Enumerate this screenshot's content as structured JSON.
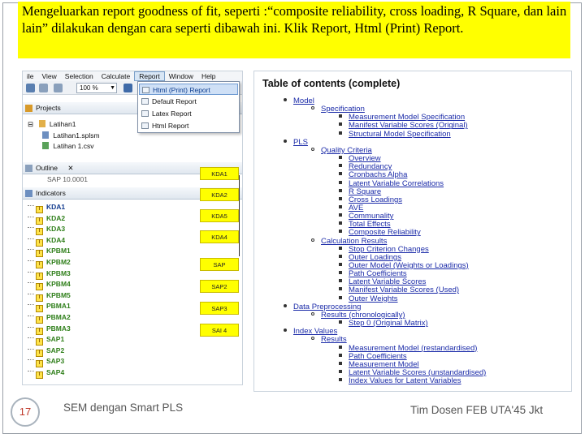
{
  "banner": {
    "text": "Mengeluarkan report goodness of fit, seperti  :“composite reliability, cross loading,  R Square,  dan lain lain”  dilakukan dengan cara seperti dibawah ini. Klik Report, Html (Print) Report."
  },
  "app": {
    "menu": [
      "ile",
      "View",
      "Selection",
      "Calculate",
      "Report",
      "Window",
      "Help"
    ],
    "zoom_value": "100 %",
    "report_menu": [
      {
        "label": "Html (Print) Report",
        "icon": "html-report-icon",
        "selected": true
      },
      {
        "label": "Default Report",
        "icon": "default-report-icon"
      },
      {
        "label": "Latex Report",
        "icon": "latex-report-icon"
      },
      {
        "label": "Html Report",
        "icon": "html-report-icon"
      }
    ],
    "projects_title": "Projects",
    "project_tree": [
      "Latihan1",
      "Latihan1.splsm",
      "Latihan 1.csv"
    ],
    "outline_title": "Outline",
    "outline_close": "✕",
    "outline_item": "SAP 10.0001",
    "indicators_title": "Indicators",
    "indicators": [
      "KDA1",
      "KDA2",
      "KDA3",
      "KDA4",
      "KPBM1",
      "KPBM2",
      "KPBM3",
      "KPBM4",
      "KPBM5",
      "PBMA1",
      "PBMA2",
      "PBMA3",
      "SAP1",
      "SAP2",
      "SAP3",
      "SAP4"
    ],
    "canvas_boxes": [
      "KDA1",
      "KDA2",
      "KDA5",
      "KDA4",
      "SAP",
      "SAP2",
      "SAP3",
      "SAI 4"
    ],
    "colors": {
      "indicator_text": "#2f7f1a",
      "box_fill": "#ffff00",
      "menu_highlight": "#cfe0f6"
    }
  },
  "report": {
    "title": "Table of contents (complete)",
    "entries": [
      {
        "level": 1,
        "text": "Model"
      },
      {
        "level": 2,
        "text": "Specification"
      },
      {
        "level": 3,
        "text": "Measurement Model Specification"
      },
      {
        "level": 3,
        "text": "Manifest Variable Scores (Original)"
      },
      {
        "level": 3,
        "text": "Structural Model Specification"
      },
      {
        "level": 1,
        "text": "PLS"
      },
      {
        "level": 2,
        "text": "Quality Criteria"
      },
      {
        "level": 3,
        "text": "Overview"
      },
      {
        "level": 3,
        "text": "Redundancy"
      },
      {
        "level": 3,
        "text": "Cronbachs Alpha"
      },
      {
        "level": 3,
        "text": "Latent Variable Correlations"
      },
      {
        "level": 3,
        "text": "R Square"
      },
      {
        "level": 3,
        "text": "Cross Loadings"
      },
      {
        "level": 3,
        "text": "AVE"
      },
      {
        "level": 3,
        "text": "Communality"
      },
      {
        "level": 3,
        "text": "Total Effects"
      },
      {
        "level": 3,
        "text": "Composite Reliability"
      },
      {
        "level": 2,
        "text": "Calculation Results"
      },
      {
        "level": 3,
        "text": "Stop Criterion Changes"
      },
      {
        "level": 3,
        "text": "Outer Loadings"
      },
      {
        "level": 3,
        "text": "Outer Model (Weights or Loadings)"
      },
      {
        "level": 3,
        "text": "Path Coefficients"
      },
      {
        "level": 3,
        "text": "Latent Variable Scores"
      },
      {
        "level": 3,
        "text": "Manifest Variable Scores (Used)"
      },
      {
        "level": 3,
        "text": "Outer Weights"
      },
      {
        "level": 1,
        "text": "Data Preprocessing"
      },
      {
        "level": 2,
        "text": "Results (chronologically)"
      },
      {
        "level": 3,
        "text": "Step 0 (Original Matrix)"
      },
      {
        "level": 1,
        "text": "Index Values"
      },
      {
        "level": 2,
        "text": "Results"
      },
      {
        "level": 3,
        "text": "Measurement Model (restandardised)"
      },
      {
        "level": 3,
        "text": "Path Coefficients"
      },
      {
        "level": 3,
        "text": "Measurement Model"
      },
      {
        "level": 3,
        "text": "Latent Variable Scores (unstandardised)"
      },
      {
        "level": 3,
        "text": "Index Values for Latent Variables"
      }
    ]
  },
  "footer": {
    "slide_number": "17",
    "left": "SEM dengan Smart PLS",
    "right": "Tim Dosen FEB UTA'45 Jkt"
  }
}
